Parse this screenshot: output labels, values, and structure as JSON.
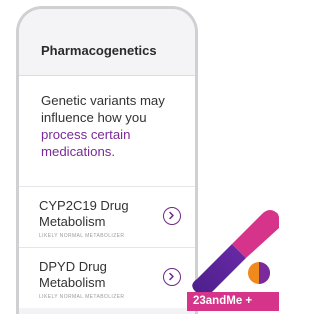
{
  "screen": {
    "title": "Pharmacogenetics",
    "intro": {
      "text_before": "Genetic variants may influence how you ",
      "link": "process certain medications."
    },
    "reports": [
      {
        "name": "CYP2C19 Drug Metabolism",
        "status": "LIKELY NORMAL METABOLIZER"
      },
      {
        "name": "DPYD Drug Metabolism",
        "status": "LIKELY NORMAL METABOLIZER"
      }
    ]
  },
  "brand_badge": "23andMe +",
  "colors": {
    "accent_purple": "#6b2a86",
    "pill_magenta": "#d6338a",
    "pill_purple": "#4a1f8a",
    "dot_orange": "#f08a1c"
  },
  "icons": {
    "report_chevron": "chevron-right-icon",
    "decoration": "pill-capsule-icon"
  }
}
